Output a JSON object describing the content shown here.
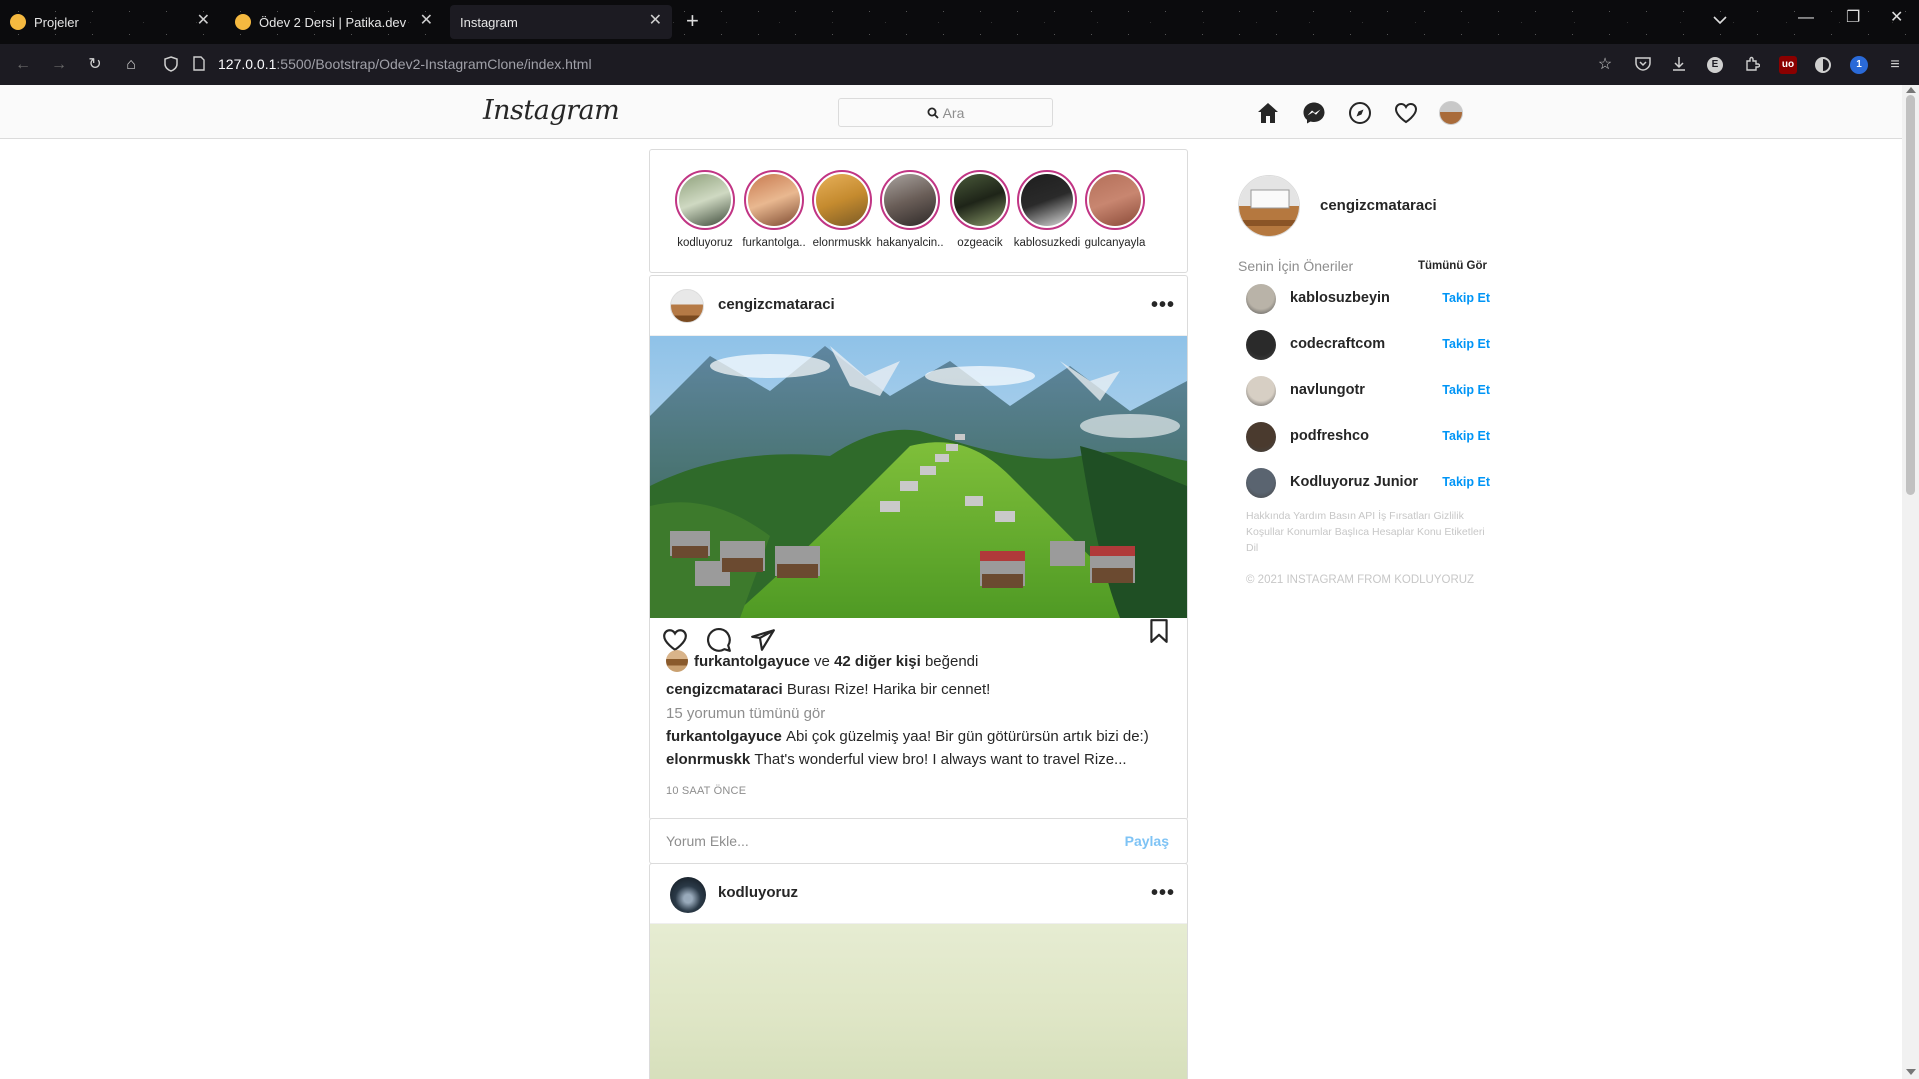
{
  "browser": {
    "tabs": [
      {
        "title": "Projeler",
        "active": false
      },
      {
        "title": "Ödev 2 Dersi | Patika.dev",
        "active": false
      },
      {
        "title": "Instagram",
        "active": true
      }
    ],
    "url_host": "127.0.0.1",
    "url_rest": ":5500/Bootstrap/Odev2-InstagramClone/index.html",
    "extension_badge": "1"
  },
  "header": {
    "logo": "Instagram",
    "search_placeholder": "Ara"
  },
  "stories": [
    {
      "name": "kodluyoruz",
      "colors": [
        "#8fa17c",
        "#cfd9c2",
        "#3d4a3a"
      ]
    },
    {
      "name": "furkantolga..",
      "colors": [
        "#c87a50",
        "#e9b890",
        "#7d4a30"
      ]
    },
    {
      "name": "elonrmuskk",
      "colors": [
        "#e7b05a",
        "#c58b2f",
        "#7a5a25"
      ]
    },
    {
      "name": "hakanyalcin..",
      "colors": [
        "#a9a39f",
        "#6a5e58",
        "#2e2928"
      ]
    },
    {
      "name": "ozgeacik",
      "colors": [
        "#4a5a3a",
        "#1e2418",
        "#8a9a6a"
      ]
    },
    {
      "name": "kablosuzkedi",
      "colors": [
        "#1e1e1e",
        "#2a2a2a",
        "#e0e0e0"
      ]
    },
    {
      "name": "gulcanyayla",
      "colors": [
        "#b4705a",
        "#c88670",
        "#8a4a38"
      ]
    }
  ],
  "post1": {
    "username": "cengizcmataraci",
    "liked_by": "furkantolgayuce",
    "likes_and": "ve",
    "likes_others": "42 diğer kişi",
    "likes_suffix": "beğendi",
    "caption_user": "cengizcmataraci",
    "caption_text": "Burası Rize! Harika bir cennet!",
    "view_comments": "15 yorumun tümünü gör",
    "comments": [
      {
        "user": "furkantolgayuce",
        "text": "Abi çok güzelmiş yaa! Bir gün götürürsün artık bizi de:)"
      },
      {
        "user": "elonrmuskk",
        "text": "That's wonderful view bro! I always want to travel Rize..."
      }
    ],
    "time_ago": "10 SAAT ÖNCE"
  },
  "comment_box": {
    "placeholder": "Yorum Ekle...",
    "share": "Paylaş"
  },
  "post2": {
    "username": "kodluyoruz"
  },
  "sidebar": {
    "username": "cengizcmataraci",
    "suggestions_title": "Senin İçin Öneriler",
    "see_all": "Tümünü Gör",
    "follow_label": "Takip Et",
    "suggestions": [
      {
        "name": "kablosuzbeyin",
        "color": "#b9b3a8"
      },
      {
        "name": "codecraftcom",
        "color": "#2a2a2a"
      },
      {
        "name": "navlungotr",
        "color": "#d7cfc4"
      },
      {
        "name": "podfreshco",
        "color": "#4a3a2e"
      },
      {
        "name": "Kodluyoruz Junior",
        "color": "#5a6470"
      }
    ],
    "footer_links": "Hakkında Yardım Basın API İş Fırsatları Gizlilik Koşullar Konumlar Başlıca Hesaplar Konu Etiketleri Dil",
    "copyright": "© 2021 INSTAGRAM FROM KODLUYORUZ"
  }
}
